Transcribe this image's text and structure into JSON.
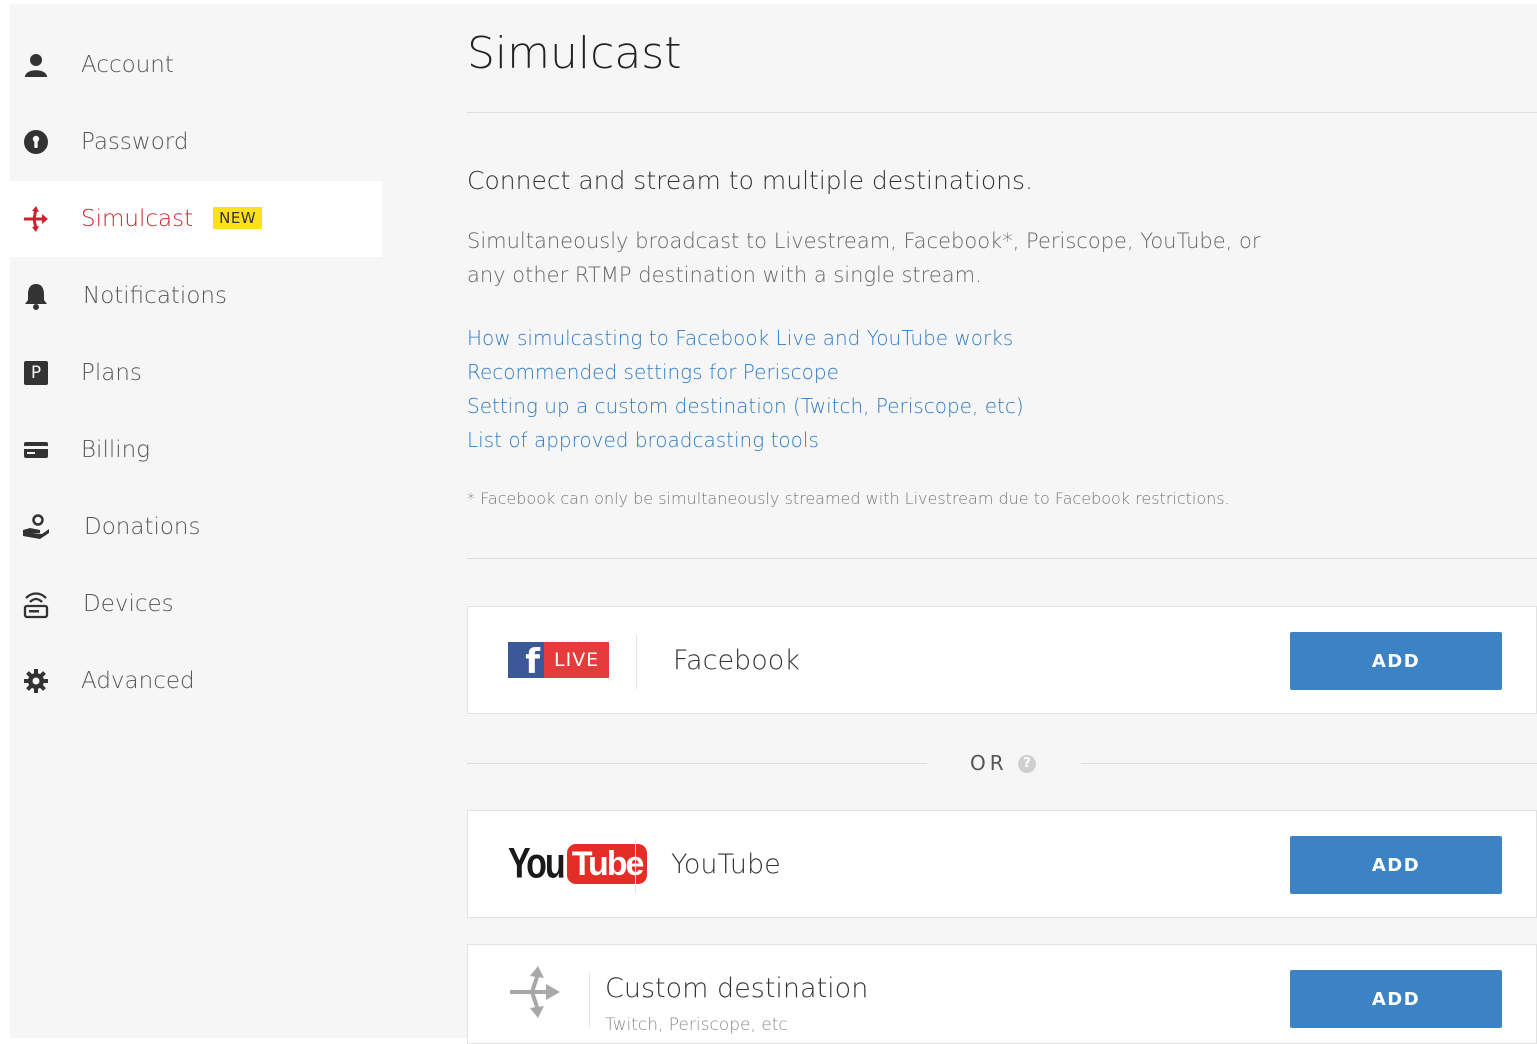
{
  "sidebar": {
    "items": [
      {
        "label": "Account",
        "icon": "user-icon"
      },
      {
        "label": "Password",
        "icon": "lock-icon"
      },
      {
        "label": "Simulcast",
        "icon": "simulcast-icon",
        "badge": "NEW",
        "active": true
      },
      {
        "label": "Notifications",
        "icon": "bell-icon"
      },
      {
        "label": "Plans",
        "icon": "plans-icon",
        "glyph": "P"
      },
      {
        "label": "Billing",
        "icon": "credit-card-icon"
      },
      {
        "label": "Donations",
        "icon": "donation-hand-icon"
      },
      {
        "label": "Devices",
        "icon": "device-icon"
      },
      {
        "label": "Advanced",
        "icon": "gear-icon"
      }
    ]
  },
  "main": {
    "title": "Simulcast",
    "subtitle": "Connect and stream to multiple destinations.",
    "description_line1": "Simultaneously broadcast to Livestream, Facebook*, Periscope, YouTube, or",
    "description_line2": "any other RTMP destination with a single stream.",
    "links": [
      "How simulcasting to Facebook Live and YouTube works",
      "Recommended settings for Periscope",
      "Setting up a custom destination (Twitch, Periscope, etc)",
      "List of approved broadcasting tools"
    ],
    "footnote": "* Facebook can only be simultaneously streamed with Livestream due to Facebook restrictions.",
    "or_label": "OR",
    "help_glyph": "?",
    "destinations": {
      "facebook": {
        "name": "Facebook",
        "logo_f": "f",
        "logo_live": "LIVE",
        "button": "ADD"
      },
      "youtube": {
        "name": "YouTube",
        "logo_you": "You",
        "logo_tube": "Tube",
        "button": "ADD"
      },
      "custom": {
        "name": "Custom destination",
        "subtitle": "Twitch, Periscope, etc",
        "button": "ADD"
      }
    }
  },
  "colors": {
    "accent_link": "#2e7bc4",
    "button": "#3b83c4",
    "active_red": "#d0202e",
    "badge_yellow": "#ffe11a",
    "facebook_blue": "#3b5998",
    "live_red": "#e63b3b",
    "youtube_red": "#e52d27"
  }
}
